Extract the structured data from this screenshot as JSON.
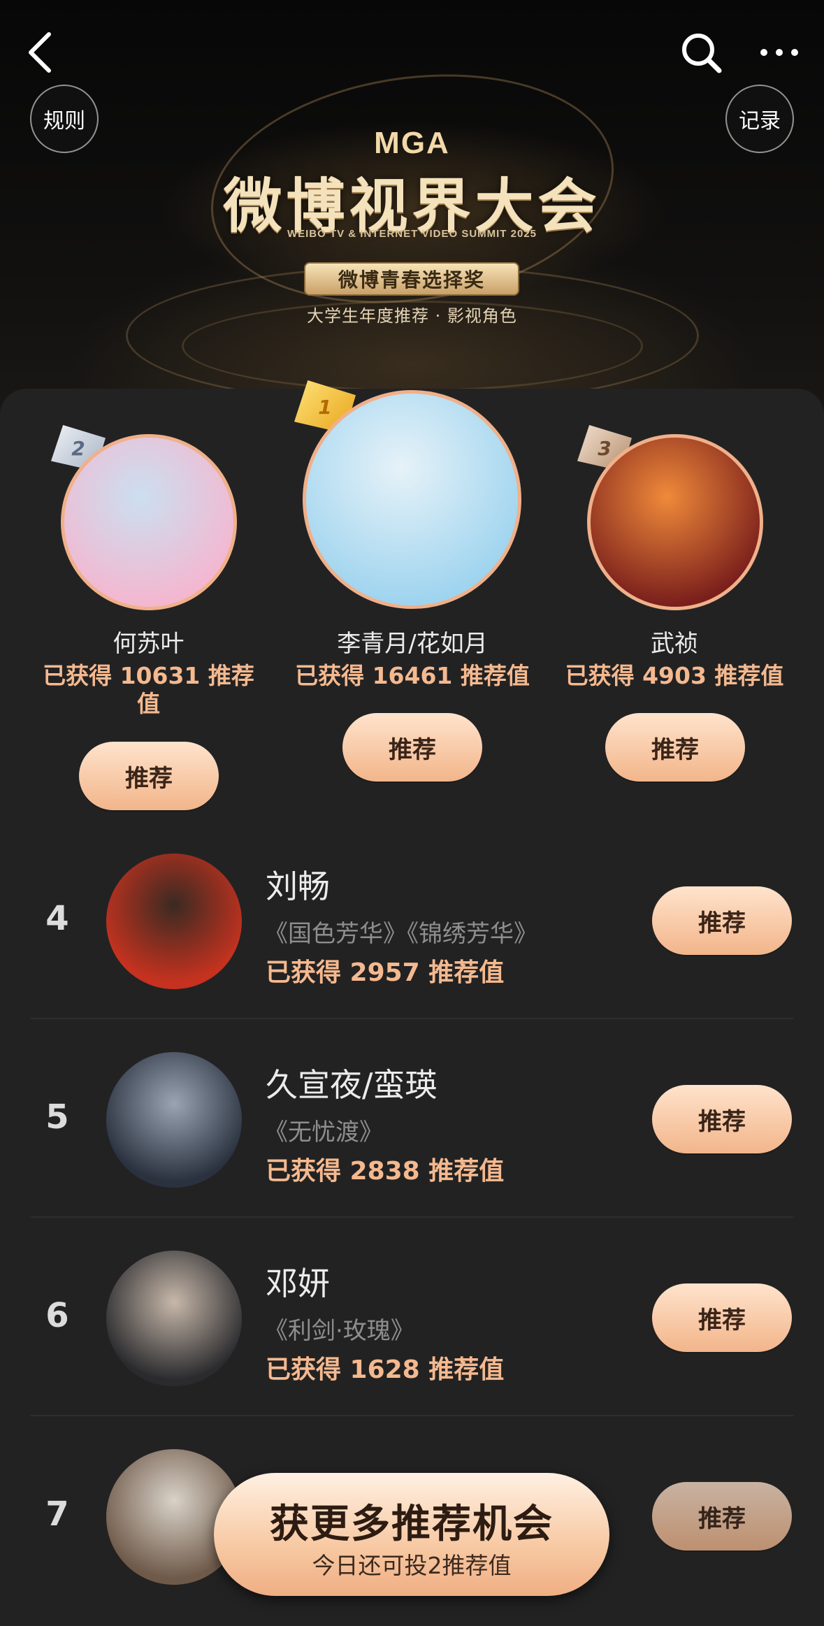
{
  "header": {
    "rules_label": "规则",
    "record_label": "记录",
    "logo_mark": "MGA",
    "logo_title": "微博视界大会",
    "logo_subtitle": "WEIBO TV & INTERNET VIDEO SUMMIT 2025",
    "award_name": "微博青春选择奖",
    "award_category": "大学生年度推荐 · 影视角色"
  },
  "podium": [
    {
      "rank": "2",
      "name": "何苏叶",
      "score_text": "已获得 10631 推荐值",
      "button_label": "推荐",
      "color_a": "#f4b7d0",
      "color_b": "#cbdff0"
    },
    {
      "rank": "1",
      "name": "李青月/花如月",
      "score_text": "已获得 16461 推荐值",
      "button_label": "推荐",
      "color_a": "#9fd4ef",
      "color_b": "#e6f2f8"
    },
    {
      "rank": "3",
      "name": "武祯",
      "score_text": "已获得 4903 推荐值",
      "button_label": "推荐",
      "color_a": "#7a1f1c",
      "color_b": "#f08a3a"
    }
  ],
  "list": [
    {
      "rank": "4",
      "name": "刘畅",
      "works": "《国色芳华》《锦绣芳华》",
      "score_text": "已获得 2957 推荐值",
      "button_label": "推荐",
      "color_a": "#c6321f",
      "color_b": "#3a2a22"
    },
    {
      "rank": "5",
      "name": "久宣夜/蛮瑛",
      "works": "《无忧渡》",
      "score_text": "已获得 2838 推荐值",
      "button_label": "推荐",
      "color_a": "#2a3240",
      "color_b": "#9aa4b2"
    },
    {
      "rank": "6",
      "name": "邓妍",
      "works": "《利剑·玫瑰》",
      "score_text": "已获得 1628 推荐值",
      "button_label": "推荐",
      "color_a": "#2b2b2e",
      "color_b": "#c7b8aa"
    },
    {
      "rank": "7",
      "name": "",
      "works": "",
      "score_text": "",
      "button_label": "推荐",
      "color_a": "#6f5a4a",
      "color_b": "#d9d2c8"
    }
  ],
  "cta": {
    "title": "获更多推荐机会",
    "subtitle": "今日还可投2推荐值"
  },
  "icons": [
    "back-arrow-icon",
    "search-icon",
    "more-icon"
  ],
  "colors": {
    "accent": "#f5b98f",
    "button_top": "#ffe3cc",
    "button_bottom": "#f2b58a",
    "panel": "#222223",
    "gold": "#e7a418"
  }
}
